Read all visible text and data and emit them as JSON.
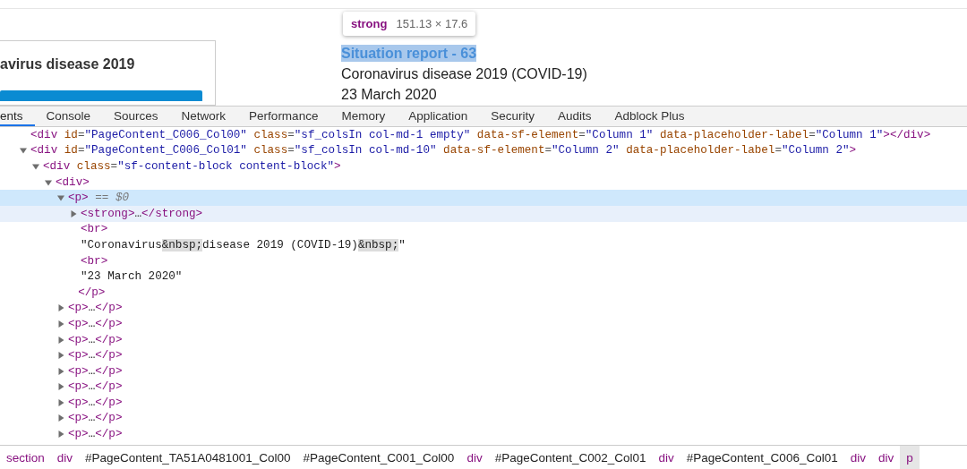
{
  "page": {
    "card_heading": "avirus disease 2019",
    "tooltip": {
      "tag": "strong",
      "size": "151.13 × 17.6"
    },
    "title": "Situation report - 63",
    "subtitle": "Coronavirus disease 2019 (COVID-19)",
    "date": "23 March 2020"
  },
  "tabs": [
    {
      "label": "ents",
      "selected": true
    },
    {
      "label": "Console",
      "selected": false
    },
    {
      "label": "Sources",
      "selected": false
    },
    {
      "label": "Network",
      "selected": false
    },
    {
      "label": "Performance",
      "selected": false
    },
    {
      "label": "Memory",
      "selected": false
    },
    {
      "label": "Application",
      "selected": false
    },
    {
      "label": "Security",
      "selected": false
    },
    {
      "label": "Audits",
      "selected": false
    },
    {
      "label": "Adblock Plus",
      "selected": false
    }
  ],
  "tree": {
    "nodes": [
      {
        "kind": "leaf",
        "selected": false,
        "hovered": false,
        "tokens": [
          {
            "kind": "tag",
            "text": "<div"
          },
          {
            "kind": "attr",
            "text": " id"
          },
          {
            "kind": "punct",
            "text": "="
          },
          {
            "kind": "value",
            "text": "\"PageContent_C006_Col00\""
          },
          {
            "kind": "attr",
            "text": " class"
          },
          {
            "kind": "punct",
            "text": "="
          },
          {
            "kind": "value",
            "text": "\"sf_colsIn col-md-1 empty\""
          },
          {
            "kind": "attr",
            "text": " data-sf-element"
          },
          {
            "kind": "punct",
            "text": "="
          },
          {
            "kind": "value",
            "text": "\"Column 1\""
          },
          {
            "kind": "attr",
            "text": " data-placeholder-label"
          },
          {
            "kind": "punct",
            "text": "="
          },
          {
            "kind": "value",
            "text": "\"Column 1\""
          },
          {
            "kind": "tag",
            "text": "></div>"
          }
        ]
      },
      {
        "kind": "element",
        "expanded": true,
        "selected": false,
        "hovered": false,
        "tokens": [
          {
            "kind": "tag",
            "text": "<div"
          },
          {
            "kind": "attr",
            "text": " id"
          },
          {
            "kind": "punct",
            "text": "="
          },
          {
            "kind": "value",
            "text": "\"PageContent_C006_Col01\""
          },
          {
            "kind": "attr",
            "text": " class"
          },
          {
            "kind": "punct",
            "text": "="
          },
          {
            "kind": "value",
            "text": "\"sf_colsIn col-md-10\""
          },
          {
            "kind": "attr",
            "text": " data-sf-element"
          },
          {
            "kind": "punct",
            "text": "="
          },
          {
            "kind": "value",
            "text": "\"Column 2\""
          },
          {
            "kind": "attr",
            "text": " data-placeholder-label"
          },
          {
            "kind": "punct",
            "text": "="
          },
          {
            "kind": "value",
            "text": "\"Column 2\""
          },
          {
            "kind": "tag",
            "text": ">"
          }
        ],
        "children": [
          {
            "kind": "element",
            "expanded": true,
            "selected": false,
            "hovered": false,
            "tokens": [
              {
                "kind": "tag",
                "text": "<div"
              },
              {
                "kind": "attr",
                "text": " class"
              },
              {
                "kind": "punct",
                "text": "="
              },
              {
                "kind": "value",
                "text": "\"sf-content-block content-block\""
              },
              {
                "kind": "tag",
                "text": ">"
              }
            ],
            "children": [
              {
                "kind": "element",
                "expanded": true,
                "selected": false,
                "hovered": false,
                "tokens": [
                  {
                    "kind": "tag",
                    "text": "<div>"
                  }
                ],
                "children": [
                  {
                    "kind": "element",
                    "expanded": true,
                    "selected": true,
                    "hovered": false,
                    "tokens": [
                      {
                        "kind": "tag",
                        "text": "<p>"
                      },
                      {
                        "kind": "marker",
                        "text": " == $0"
                      }
                    ],
                    "closing": [
                      {
                        "kind": "tag",
                        "text": "</p>"
                      }
                    ],
                    "children": [
                      {
                        "kind": "element",
                        "expanded": false,
                        "selected": false,
                        "hovered": true,
                        "tokens": [
                          {
                            "kind": "tag",
                            "text": "<strong>"
                          },
                          {
                            "kind": "text",
                            "text": "…"
                          },
                          {
                            "kind": "tag",
                            "text": "</strong>"
                          }
                        ]
                      },
                      {
                        "kind": "leaf",
                        "selected": false,
                        "hovered": false,
                        "tokens": [
                          {
                            "kind": "tag",
                            "text": "<br>"
                          }
                        ]
                      },
                      {
                        "kind": "leaf",
                        "selected": false,
                        "hovered": false,
                        "tokens": [
                          {
                            "kind": "text",
                            "text": "\"Coronavirus"
                          },
                          {
                            "kind": "entity",
                            "text": "&nbsp;"
                          },
                          {
                            "kind": "text",
                            "text": "disease 2019 (COVID-19)"
                          },
                          {
                            "kind": "entity",
                            "text": "&nbsp;"
                          },
                          {
                            "kind": "text",
                            "text": "\""
                          }
                        ]
                      },
                      {
                        "kind": "leaf",
                        "selected": false,
                        "hovered": false,
                        "tokens": [
                          {
                            "kind": "tag",
                            "text": "<br>"
                          }
                        ]
                      },
                      {
                        "kind": "leaf",
                        "selected": false,
                        "hovered": false,
                        "tokens": [
                          {
                            "kind": "text",
                            "text": "\"23 March 2020\""
                          }
                        ]
                      }
                    ]
                  },
                  {
                    "kind": "element",
                    "expanded": false,
                    "selected": false,
                    "hovered": false,
                    "tokens": [
                      {
                        "kind": "tag",
                        "text": "<p>"
                      },
                      {
                        "kind": "text",
                        "text": "…"
                      },
                      {
                        "kind": "tag",
                        "text": "</p>"
                      }
                    ]
                  },
                  {
                    "kind": "element",
                    "expanded": false,
                    "selected": false,
                    "hovered": false,
                    "tokens": [
                      {
                        "kind": "tag",
                        "text": "<p>"
                      },
                      {
                        "kind": "text",
                        "text": "…"
                      },
                      {
                        "kind": "tag",
                        "text": "</p>"
                      }
                    ]
                  },
                  {
                    "kind": "element",
                    "expanded": false,
                    "selected": false,
                    "hovered": false,
                    "tokens": [
                      {
                        "kind": "tag",
                        "text": "<p>"
                      },
                      {
                        "kind": "text",
                        "text": "…"
                      },
                      {
                        "kind": "tag",
                        "text": "</p>"
                      }
                    ]
                  },
                  {
                    "kind": "element",
                    "expanded": false,
                    "selected": false,
                    "hovered": false,
                    "tokens": [
                      {
                        "kind": "tag",
                        "text": "<p>"
                      },
                      {
                        "kind": "text",
                        "text": "…"
                      },
                      {
                        "kind": "tag",
                        "text": "</p>"
                      }
                    ]
                  },
                  {
                    "kind": "element",
                    "expanded": false,
                    "selected": false,
                    "hovered": false,
                    "tokens": [
                      {
                        "kind": "tag",
                        "text": "<p>"
                      },
                      {
                        "kind": "text",
                        "text": "…"
                      },
                      {
                        "kind": "tag",
                        "text": "</p>"
                      }
                    ]
                  },
                  {
                    "kind": "element",
                    "expanded": false,
                    "selected": false,
                    "hovered": false,
                    "tokens": [
                      {
                        "kind": "tag",
                        "text": "<p>"
                      },
                      {
                        "kind": "text",
                        "text": "…"
                      },
                      {
                        "kind": "tag",
                        "text": "</p>"
                      }
                    ]
                  },
                  {
                    "kind": "element",
                    "expanded": false,
                    "selected": false,
                    "hovered": false,
                    "tokens": [
                      {
                        "kind": "tag",
                        "text": "<p>"
                      },
                      {
                        "kind": "text",
                        "text": "…"
                      },
                      {
                        "kind": "tag",
                        "text": "</p>"
                      }
                    ]
                  },
                  {
                    "kind": "element",
                    "expanded": false,
                    "selected": false,
                    "hovered": false,
                    "tokens": [
                      {
                        "kind": "tag",
                        "text": "<p>"
                      },
                      {
                        "kind": "text",
                        "text": "…"
                      },
                      {
                        "kind": "tag",
                        "text": "</p>"
                      }
                    ]
                  },
                  {
                    "kind": "element",
                    "expanded": false,
                    "selected": false,
                    "hovered": false,
                    "tokens": [
                      {
                        "kind": "tag",
                        "text": "<p>"
                      },
                      {
                        "kind": "text",
                        "text": "…"
                      },
                      {
                        "kind": "tag",
                        "text": "</p>"
                      }
                    ]
                  }
                ]
              }
            ]
          }
        ]
      }
    ]
  },
  "breadcrumb": [
    {
      "kind": "tag",
      "text": "section",
      "selected": false
    },
    {
      "kind": "tag",
      "text": "div",
      "selected": false
    },
    {
      "kind": "id",
      "text": "#PageContent_TA51A0481001_Col00",
      "selected": false
    },
    {
      "kind": "id",
      "text": "#PageContent_C001_Col00",
      "selected": false
    },
    {
      "kind": "tag",
      "text": "div",
      "selected": false
    },
    {
      "kind": "id",
      "text": "#PageContent_C002_Col01",
      "selected": false
    },
    {
      "kind": "tag",
      "text": "div",
      "selected": false
    },
    {
      "kind": "id",
      "text": "#PageContent_C006_Col01",
      "selected": false
    },
    {
      "kind": "tag",
      "text": "div",
      "selected": false
    },
    {
      "kind": "tag",
      "text": "div",
      "selected": false
    },
    {
      "kind": "tag",
      "text": "p",
      "selected": true
    }
  ]
}
